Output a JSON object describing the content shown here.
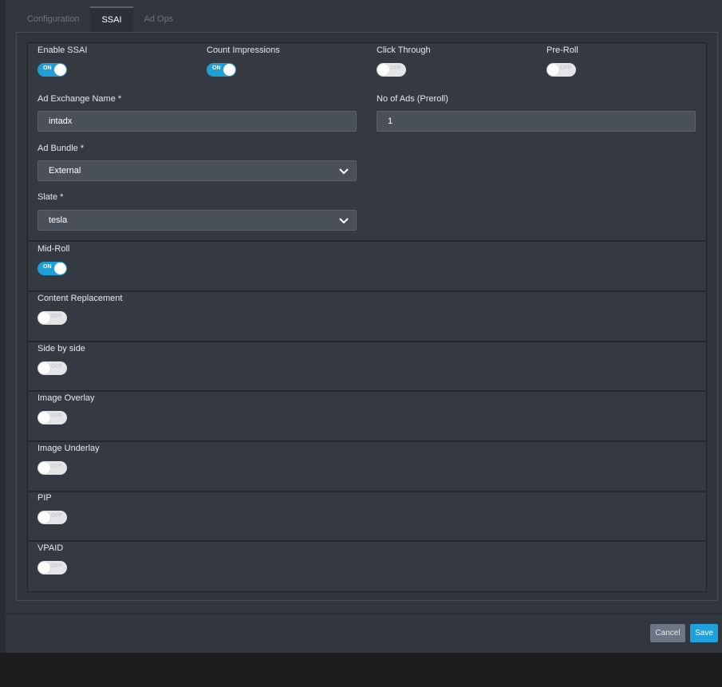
{
  "tabs": [
    {
      "label": "Configuration"
    },
    {
      "label": "SSAI"
    },
    {
      "label": "Ad Ops"
    }
  ],
  "active_tab": "SSAI",
  "toggle_text": {
    "on": "ON",
    "off": "OFF"
  },
  "top_toggles": [
    {
      "label": "Enable SSAI",
      "state": "on"
    },
    {
      "label": "Count Impressions",
      "state": "on"
    },
    {
      "label": "Click Through",
      "state": "off"
    },
    {
      "label": "Pre-Roll",
      "state": "off"
    }
  ],
  "fields": {
    "ad_exchange_name": {
      "label": "Ad Exchange Name *",
      "value": "intadx"
    },
    "no_of_ads": {
      "label": "No of Ads (Preroll)",
      "value": "1"
    },
    "ad_bundle": {
      "label": "Ad Bundle *",
      "value": "External"
    },
    "slate": {
      "label": "Slate *",
      "value": "tesla"
    }
  },
  "sections": [
    {
      "label": "Mid-Roll",
      "state": "on"
    },
    {
      "label": "Content Replacement",
      "state": "off"
    },
    {
      "label": "Side by side",
      "state": "off"
    },
    {
      "label": "Image Overlay",
      "state": "off"
    },
    {
      "label": "Image Underlay",
      "state": "off"
    },
    {
      "label": "PIP",
      "state": "off"
    },
    {
      "label": "VPAID",
      "state": "off"
    }
  ],
  "buttons": {
    "cancel": "Cancel",
    "save": "Save"
  },
  "colors": {
    "accent": "#1ea0dc",
    "toggle_on": "#1e9fd7",
    "panel": "#353a42"
  }
}
